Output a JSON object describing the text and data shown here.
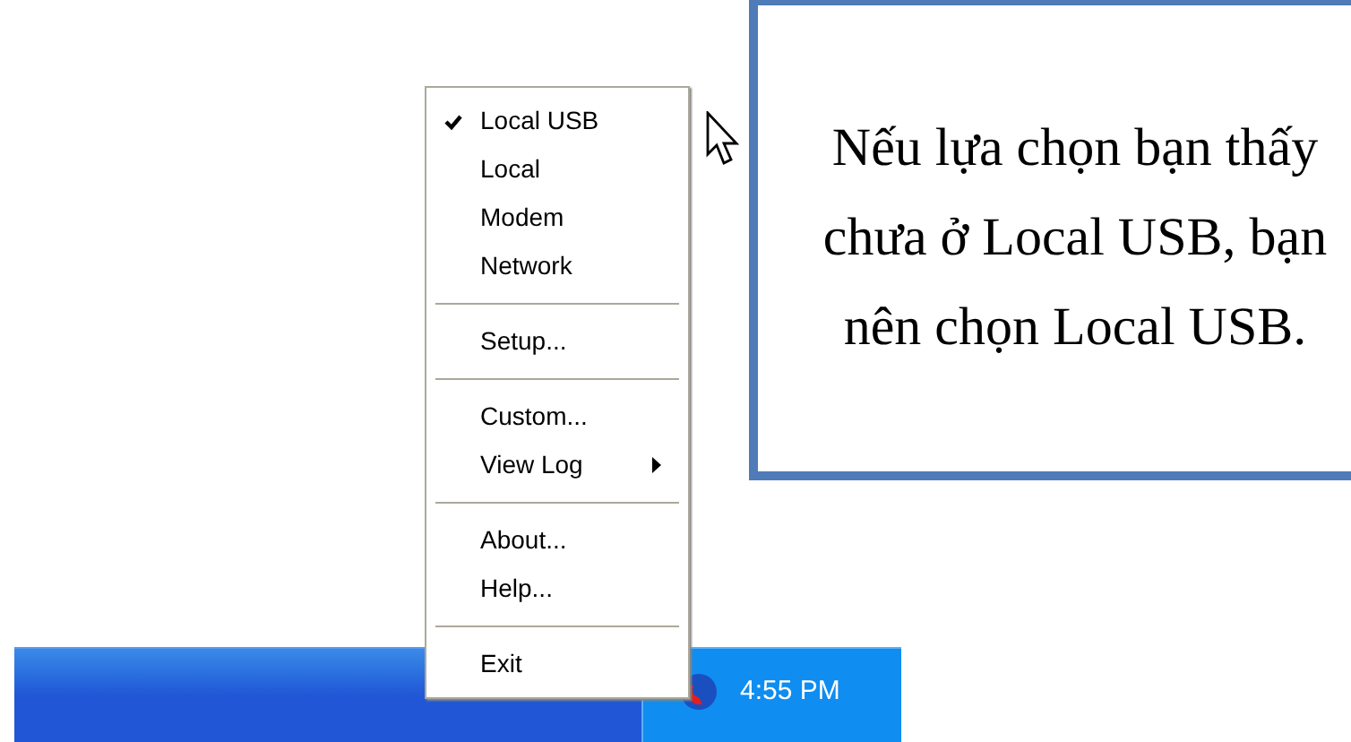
{
  "menu": {
    "items": [
      {
        "kind": "item",
        "label": "Local USB",
        "checked": true,
        "submenu": false
      },
      {
        "kind": "item",
        "label": "Local",
        "checked": false,
        "submenu": false
      },
      {
        "kind": "item",
        "label": "Modem",
        "checked": false,
        "submenu": false
      },
      {
        "kind": "item",
        "label": "Network",
        "checked": false,
        "submenu": false
      },
      {
        "kind": "separator"
      },
      {
        "kind": "item",
        "label": "Setup...",
        "checked": false,
        "submenu": false
      },
      {
        "kind": "separator"
      },
      {
        "kind": "item",
        "label": "Custom...",
        "checked": false,
        "submenu": false
      },
      {
        "kind": "item",
        "label": "View Log",
        "checked": false,
        "submenu": true
      },
      {
        "kind": "separator"
      },
      {
        "kind": "item",
        "label": "About...",
        "checked": false,
        "submenu": false
      },
      {
        "kind": "item",
        "label": "Help...",
        "checked": false,
        "submenu": false
      },
      {
        "kind": "separator"
      },
      {
        "kind": "item",
        "label": "Exit",
        "checked": false,
        "submenu": false
      }
    ]
  },
  "taskbar": {
    "clock": "4:55 PM"
  },
  "callout": {
    "text": "Nếu lựa chọn bạn thấy chưa ở Local USB, bạn nên chọn Local USB."
  }
}
